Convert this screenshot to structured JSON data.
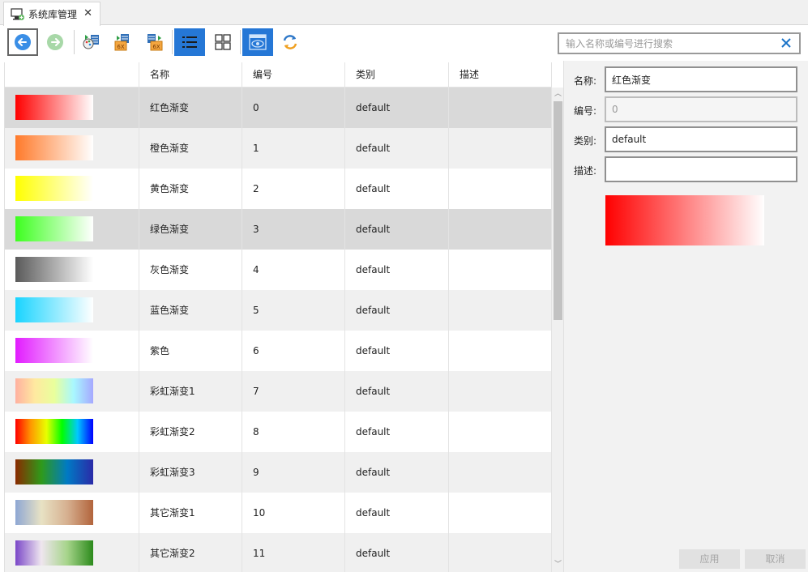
{
  "tab": {
    "title": "系统库管理",
    "close_label": "✕"
  },
  "toolbar": {
    "buttons": [
      {
        "name": "back-button",
        "icon": "arrow-left-icon",
        "state": "bordered"
      },
      {
        "name": "forward-button",
        "icon": "arrow-right-icon",
        "state": "disabled"
      },
      {
        "name": "import-button",
        "icon": "import-palette-icon"
      },
      {
        "name": "export-6x-button",
        "icon": "export-6x-icon"
      },
      {
        "name": "export-6x-alt-button",
        "icon": "export-6x-alt-icon"
      },
      {
        "name": "list-view-button",
        "icon": "list-view-icon",
        "state": "active"
      },
      {
        "name": "grid-view-button",
        "icon": "grid-view-icon"
      },
      {
        "name": "preview-button",
        "icon": "eye-icon",
        "state": "active"
      },
      {
        "name": "refresh-button",
        "icon": "refresh-icon"
      }
    ],
    "search": {
      "placeholder": "输入名称或编号进行搜索",
      "value": ""
    }
  },
  "table": {
    "columns": [
      "",
      "名称",
      "编号",
      "类别",
      "描述"
    ],
    "rows": [
      {
        "name": "红色渐变",
        "id": "0",
        "category": "default",
        "desc": "",
        "gradient": [
          "#ff0000",
          "#ffffff"
        ],
        "state": "selected"
      },
      {
        "name": "橙色渐变",
        "id": "1",
        "category": "default",
        "desc": "",
        "gradient": [
          "#ff7a2a",
          "#ffffff"
        ],
        "state": "alt"
      },
      {
        "name": "黄色渐变",
        "id": "2",
        "category": "default",
        "desc": "",
        "gradient": [
          "#ffff00",
          "#ffffff"
        ],
        "state": ""
      },
      {
        "name": "绿色渐变",
        "id": "3",
        "category": "default",
        "desc": "",
        "gradient": [
          "#3dff1f",
          "#ffffff"
        ],
        "state": "selected"
      },
      {
        "name": "灰色渐变",
        "id": "4",
        "category": "default",
        "desc": "",
        "gradient": [
          "#5a5a5a",
          "#ffffff"
        ],
        "state": ""
      },
      {
        "name": "蓝色渐变",
        "id": "5",
        "category": "default",
        "desc": "",
        "gradient": [
          "#19d4ff",
          "#ffffff"
        ],
        "state": "alt"
      },
      {
        "name": "紫色",
        "id": "6",
        "category": "default",
        "desc": "",
        "gradient": [
          "#e21cff",
          "#ffffff"
        ],
        "state": ""
      },
      {
        "name": "彩虹渐变1",
        "id": "7",
        "category": "default",
        "desc": "",
        "gradient": [
          "#ffb0a0",
          "#ffe9a0",
          "#e9ff9c",
          "#a8f7ff",
          "#a6a8ff"
        ],
        "state": "alt"
      },
      {
        "name": "彩虹渐变2",
        "id": "8",
        "category": "default",
        "desc": "",
        "gradient": [
          "#ff0000",
          "#ff9900",
          "#e8ff00",
          "#00ff00",
          "#00c8ff",
          "#0000ff"
        ],
        "state": ""
      },
      {
        "name": "彩虹渐变3",
        "id": "9",
        "category": "default",
        "desc": "",
        "gradient": [
          "#8a2a00",
          "#2f9a1a",
          "#007ac4",
          "#2a2aa8"
        ],
        "state": "alt"
      },
      {
        "name": "其它渐变1",
        "id": "10",
        "category": "default",
        "desc": "",
        "gradient": [
          "#8ea7d4",
          "#e8e2c4",
          "#d6b090",
          "#b2643c"
        ],
        "state": ""
      },
      {
        "name": "其它渐变2",
        "id": "11",
        "category": "default",
        "desc": "",
        "gradient": [
          "#7b48c8",
          "#efe6ef",
          "#a6d48a",
          "#2c8a1c"
        ],
        "state": "alt"
      }
    ]
  },
  "form": {
    "name_label": "名称:",
    "name_value": "红色渐变",
    "id_label": "编号:",
    "id_value": "0",
    "category_label": "类别:",
    "category_value": "default",
    "desc_label": "描述:",
    "desc_value": "",
    "preview_gradient": [
      "#ff0000",
      "#ffffff"
    ],
    "apply_label": "应用",
    "cancel_label": "取消"
  }
}
